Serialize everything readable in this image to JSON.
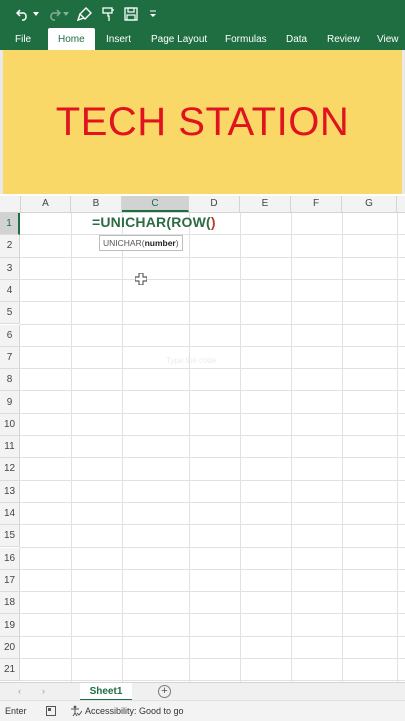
{
  "ribbon": {
    "tabs": [
      {
        "label": "File"
      },
      {
        "label": "Home"
      },
      {
        "label": "Insert"
      },
      {
        "label": "Page Layout"
      },
      {
        "label": "Formulas"
      },
      {
        "label": "Data"
      },
      {
        "label": "Review"
      },
      {
        "label": "View"
      }
    ],
    "active_tab": "Home"
  },
  "qat_icons": [
    "undo-icon",
    "dropdown-icon",
    "redo-icon",
    "format-painter-icon",
    "save-icon",
    "customize-icon"
  ],
  "banner": {
    "title": "TECH STATION"
  },
  "sheet": {
    "columns": [
      "A",
      "B",
      "C",
      "D",
      "E",
      "F",
      "G"
    ],
    "selected_column": "C",
    "rows": [
      "1",
      "2",
      "3",
      "4",
      "5",
      "6",
      "7",
      "8",
      "9",
      "10",
      "11",
      "12",
      "13",
      "14",
      "15",
      "16",
      "17",
      "18",
      "19",
      "20",
      "21"
    ],
    "selected_row": "1",
    "editing_cell": {
      "formula_main": "=UNICHAR(ROW(",
      "formula_paren": ")"
    },
    "tooltip": {
      "function": "UNICHAR(",
      "argument": "number",
      "close": ")"
    },
    "watermark": "Type the code"
  },
  "sheet_tabs": {
    "active": "Sheet1",
    "add_label": "+"
  },
  "status_bar": {
    "mode": "Enter",
    "accessibility": "Accessibility: Good to go"
  },
  "colors": {
    "excel_green": "#1e6e42",
    "banner_bg": "#fad868",
    "banner_text": "#e0141e"
  }
}
